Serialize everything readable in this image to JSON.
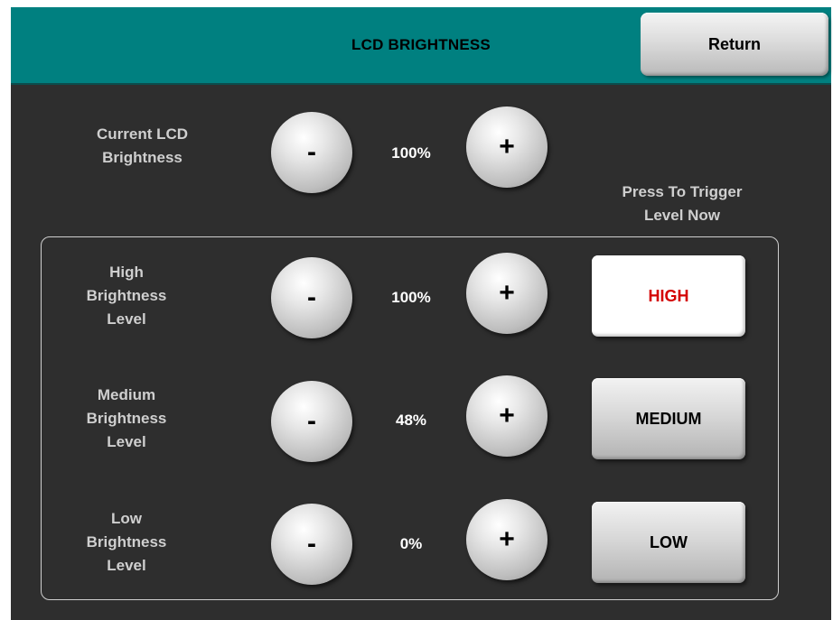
{
  "header": {
    "title": "LCD BRIGHTNESS",
    "return_label": "Return"
  },
  "current": {
    "label": "Current LCD\nBrightness",
    "value": "100%",
    "minus": "-",
    "plus": "+"
  },
  "trigger_title": "Press To Trigger\nLevel Now",
  "levels": [
    {
      "label": "High\nBrightness\nLevel",
      "value": "100%",
      "minus": "-",
      "plus": "+",
      "button": "HIGH",
      "active": true
    },
    {
      "label": "Medium\nBrightness\nLevel",
      "value": "48%",
      "minus": "-",
      "plus": "+",
      "button": "MEDIUM",
      "active": false
    },
    {
      "label": "Low\nBrightness\nLevel",
      "value": "0%",
      "minus": "-",
      "plus": "+",
      "button": "LOW",
      "active": false
    }
  ],
  "colors": {
    "header": "#008080",
    "panel": "#2e2e2e",
    "active_text": "#d40000"
  }
}
